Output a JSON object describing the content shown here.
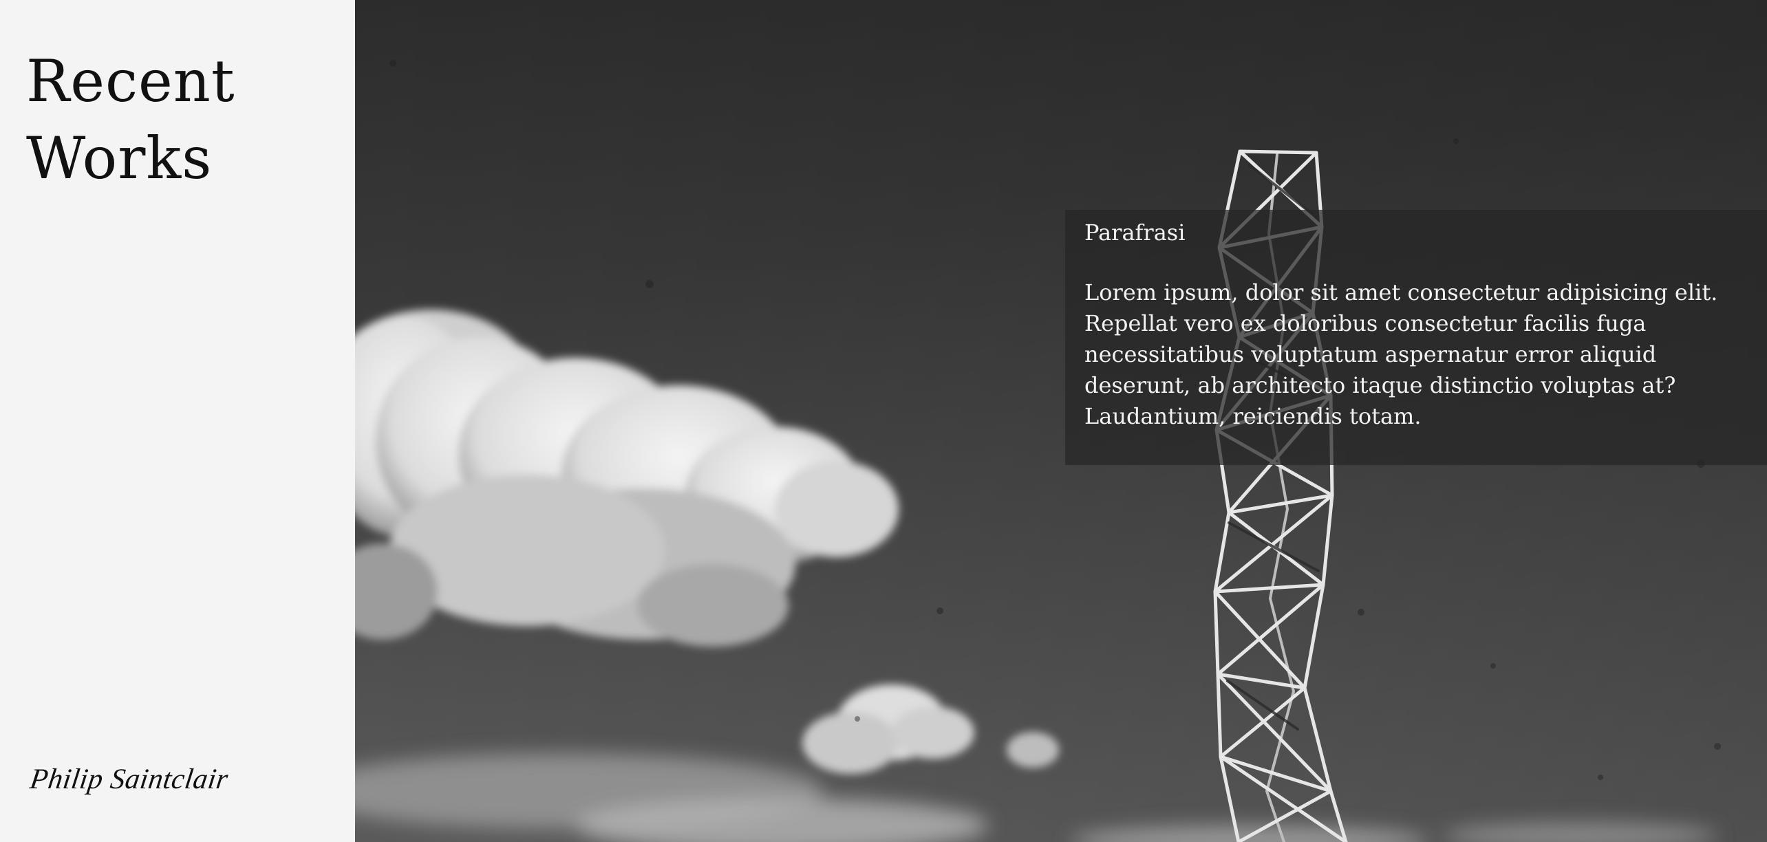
{
  "sidebar": {
    "title_line_1": "Recent",
    "title_line_2": "Works",
    "signature": "Philip Saintclair"
  },
  "hero": {
    "image_subject": "black-and-white sky with clouds and a lattice tower",
    "caption": {
      "title": "Parafrasi",
      "body": "Lorem ipsum, dolor sit amet consectetur adipisicing elit. Repellat vero ex doloribus consectetur facilis fuga necessitatibus voluptatum aspernatur error aliquid deserunt, ab architecto itaque distinctio voluptas at? Laudantium, reiciendis totam."
    }
  },
  "colors": {
    "sidebar_bg": "#f4f4f4",
    "title_text": "#111111",
    "caption_bg": "#262626",
    "caption_text": "#f2f2f2"
  }
}
